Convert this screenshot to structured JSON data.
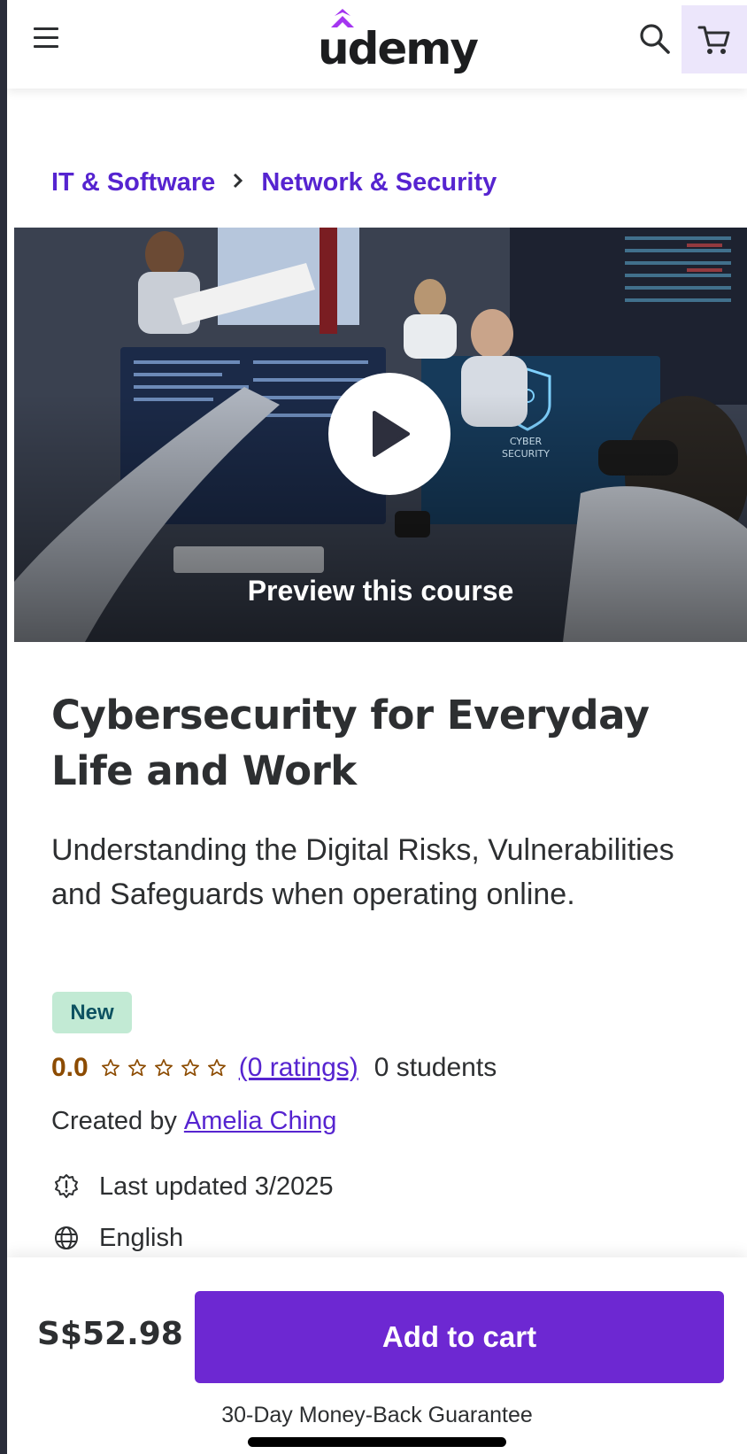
{
  "header": {
    "logo": "udemy",
    "menu_icon": "hamburger-menu-icon",
    "search_icon": "search-icon",
    "cart_icon": "shopping-cart-icon"
  },
  "breadcrumb": {
    "items": [
      "IT & Software",
      "Network & Security"
    ],
    "separator_icon": "chevron-right-icon"
  },
  "preview": {
    "label": "Preview this course",
    "play_icon": "play-icon",
    "image_alt": "office workers at computer desks with a monitor showing a CYBER SECURITY shield graphic"
  },
  "course": {
    "title": "Cybersecurity for Everyday Life and Work",
    "subtitle": "Understanding the Digital Risks, Vulnerabilities and Safeguards when operating online.",
    "badge": "New",
    "rating": "0.0",
    "rating_stars_filled": 0,
    "rating_stars_total": 5,
    "ratings_count": "(0 ratings)",
    "students": "0 students",
    "created_by_label": "Created by",
    "author": "Amelia Ching",
    "last_updated": "Last updated 3/2025",
    "language": "English"
  },
  "purchase": {
    "price": "S$52.98",
    "add_to_cart": "Add to cart",
    "guarantee": "30-Day Money-Back Guarantee"
  },
  "colors": {
    "brand_purple": "#5624d0",
    "button_purple": "#6d28d2",
    "rating_orange": "#8c4b00",
    "badge_bg": "#c2ead4",
    "cart_bg": "#ece6fb"
  }
}
